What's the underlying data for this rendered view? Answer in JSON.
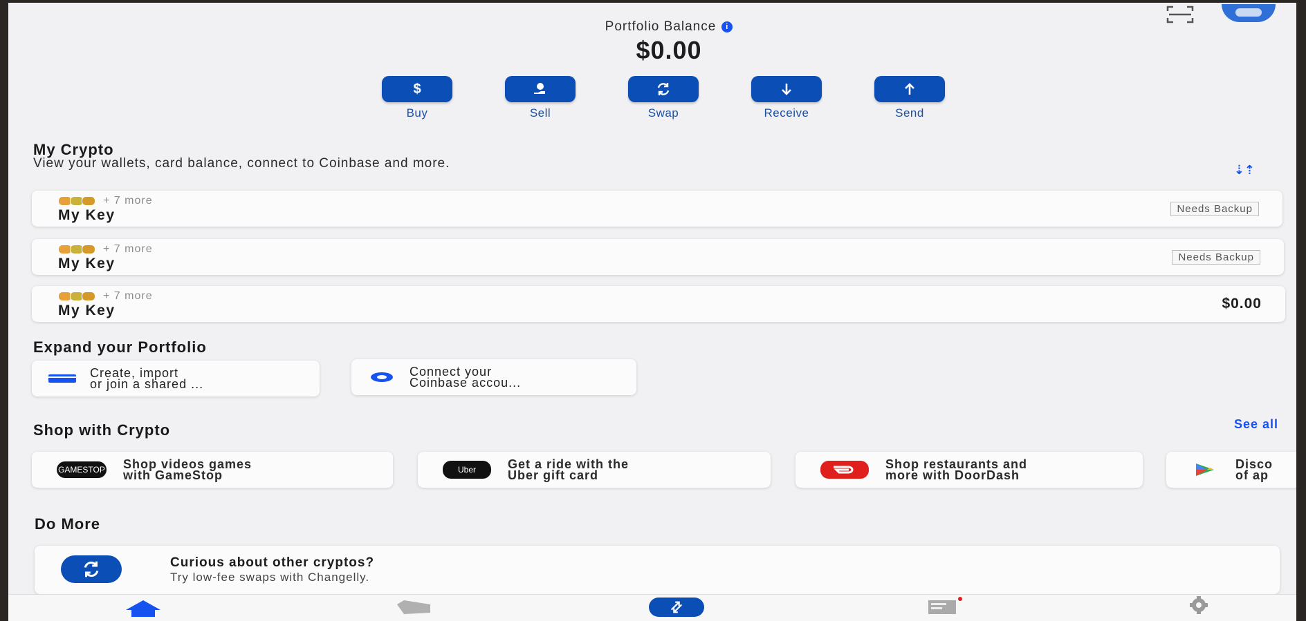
{
  "header": {
    "balance_label": "Portfolio Balance",
    "balance_value": "$0.00"
  },
  "actions": [
    {
      "label": "Buy",
      "icon": "dollar-icon"
    },
    {
      "label": "Sell",
      "icon": "hand-coin-icon"
    },
    {
      "label": "Swap",
      "icon": "swap-icon"
    },
    {
      "label": "Receive",
      "icon": "arrow-down-icon"
    },
    {
      "label": "Send",
      "icon": "arrow-up-icon"
    }
  ],
  "my_crypto": {
    "title": "My Crypto",
    "subtitle": "View your wallets, card balance, connect to Coinbase and more.",
    "wallets": [
      {
        "more": "+ 7 more",
        "name": "My Key",
        "badge": "Needs Backup"
      },
      {
        "more": "+ 7 more",
        "name": "My Key",
        "badge": "Needs Backup"
      },
      {
        "more": "+ 7 more",
        "name": "My Key",
        "balance": "$0.00"
      }
    ]
  },
  "expand": {
    "title": "Expand your Portfolio",
    "cards": [
      {
        "line1": "Create, import",
        "line2": "or join a shared ..."
      },
      {
        "line1": "Connect your",
        "line2": "Coinbase accou..."
      }
    ]
  },
  "shop": {
    "title": "Shop with Crypto",
    "see_all": "See all",
    "cards": [
      {
        "line1": "Shop videos games",
        "line2": "with GameStop",
        "logo_text": "GAMESTOP"
      },
      {
        "line1": "Get a ride with the",
        "line2": "Uber gift card",
        "logo_text": "Uber"
      },
      {
        "line1": "Shop restaurants and",
        "line2": "more with DoorDash",
        "logo_text": ""
      },
      {
        "line1": "Disco",
        "line2": "of ap",
        "logo_text": ""
      }
    ]
  },
  "do_more": {
    "title": "Do More",
    "card_title": "Curious about other cryptos?",
    "card_sub": "Try low-fee swaps with Changelly."
  },
  "colors": {
    "primary": "#1652f0",
    "button": "#0b4fb6",
    "doordash": "#e0201c"
  }
}
